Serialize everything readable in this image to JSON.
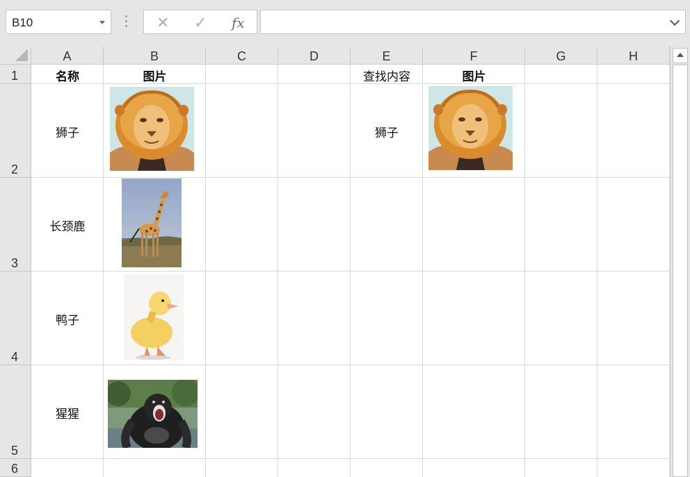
{
  "name_box": {
    "value": "B10"
  },
  "formula_bar": {
    "cancel_glyph": "✕",
    "enter_glyph": "✓",
    "fx_label": "fx",
    "content": ""
  },
  "columns": [
    "A",
    "B",
    "C",
    "D",
    "E",
    "F",
    "G",
    "H"
  ],
  "rows": [
    "1",
    "2",
    "3",
    "4",
    "5",
    "6"
  ],
  "cells": {
    "A1": "名称",
    "B1": "图片",
    "E1": "查找内容",
    "F1": "图片",
    "A2": "狮子",
    "E2": "狮子",
    "A3": "长颈鹿",
    "A4": "鸭子",
    "A5": "猩猩"
  },
  "pictures": {
    "B2": "lion",
    "F2": "lion",
    "B3": "giraffe",
    "B4": "duckling",
    "B5": "gorilla"
  },
  "colors": {
    "grid_line": "#d9d9d9",
    "header_bg": "#e6e6e6"
  }
}
